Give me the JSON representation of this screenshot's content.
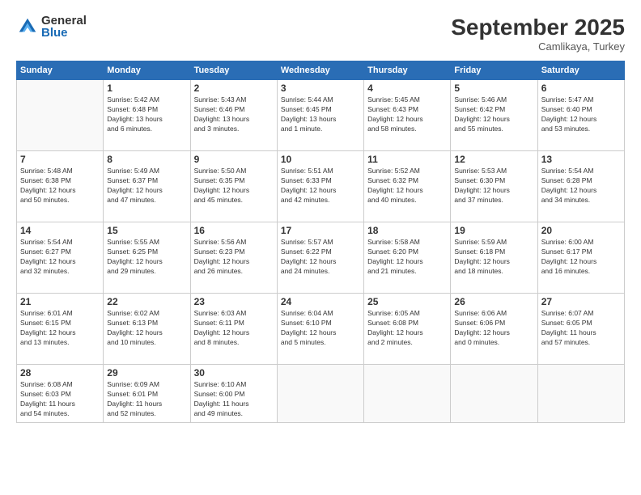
{
  "logo": {
    "general": "General",
    "blue": "Blue"
  },
  "header": {
    "month": "September 2025",
    "location": "Camlikaya, Turkey"
  },
  "weekdays": [
    "Sunday",
    "Monday",
    "Tuesday",
    "Wednesday",
    "Thursday",
    "Friday",
    "Saturday"
  ],
  "weeks": [
    [
      {
        "day": "",
        "info": ""
      },
      {
        "day": "1",
        "info": "Sunrise: 5:42 AM\nSunset: 6:48 PM\nDaylight: 13 hours\nand 6 minutes."
      },
      {
        "day": "2",
        "info": "Sunrise: 5:43 AM\nSunset: 6:46 PM\nDaylight: 13 hours\nand 3 minutes."
      },
      {
        "day": "3",
        "info": "Sunrise: 5:44 AM\nSunset: 6:45 PM\nDaylight: 13 hours\nand 1 minute."
      },
      {
        "day": "4",
        "info": "Sunrise: 5:45 AM\nSunset: 6:43 PM\nDaylight: 12 hours\nand 58 minutes."
      },
      {
        "day": "5",
        "info": "Sunrise: 5:46 AM\nSunset: 6:42 PM\nDaylight: 12 hours\nand 55 minutes."
      },
      {
        "day": "6",
        "info": "Sunrise: 5:47 AM\nSunset: 6:40 PM\nDaylight: 12 hours\nand 53 minutes."
      }
    ],
    [
      {
        "day": "7",
        "info": "Sunrise: 5:48 AM\nSunset: 6:38 PM\nDaylight: 12 hours\nand 50 minutes."
      },
      {
        "day": "8",
        "info": "Sunrise: 5:49 AM\nSunset: 6:37 PM\nDaylight: 12 hours\nand 47 minutes."
      },
      {
        "day": "9",
        "info": "Sunrise: 5:50 AM\nSunset: 6:35 PM\nDaylight: 12 hours\nand 45 minutes."
      },
      {
        "day": "10",
        "info": "Sunrise: 5:51 AM\nSunset: 6:33 PM\nDaylight: 12 hours\nand 42 minutes."
      },
      {
        "day": "11",
        "info": "Sunrise: 5:52 AM\nSunset: 6:32 PM\nDaylight: 12 hours\nand 40 minutes."
      },
      {
        "day": "12",
        "info": "Sunrise: 5:53 AM\nSunset: 6:30 PM\nDaylight: 12 hours\nand 37 minutes."
      },
      {
        "day": "13",
        "info": "Sunrise: 5:54 AM\nSunset: 6:28 PM\nDaylight: 12 hours\nand 34 minutes."
      }
    ],
    [
      {
        "day": "14",
        "info": "Sunrise: 5:54 AM\nSunset: 6:27 PM\nDaylight: 12 hours\nand 32 minutes."
      },
      {
        "day": "15",
        "info": "Sunrise: 5:55 AM\nSunset: 6:25 PM\nDaylight: 12 hours\nand 29 minutes."
      },
      {
        "day": "16",
        "info": "Sunrise: 5:56 AM\nSunset: 6:23 PM\nDaylight: 12 hours\nand 26 minutes."
      },
      {
        "day": "17",
        "info": "Sunrise: 5:57 AM\nSunset: 6:22 PM\nDaylight: 12 hours\nand 24 minutes."
      },
      {
        "day": "18",
        "info": "Sunrise: 5:58 AM\nSunset: 6:20 PM\nDaylight: 12 hours\nand 21 minutes."
      },
      {
        "day": "19",
        "info": "Sunrise: 5:59 AM\nSunset: 6:18 PM\nDaylight: 12 hours\nand 18 minutes."
      },
      {
        "day": "20",
        "info": "Sunrise: 6:00 AM\nSunset: 6:17 PM\nDaylight: 12 hours\nand 16 minutes."
      }
    ],
    [
      {
        "day": "21",
        "info": "Sunrise: 6:01 AM\nSunset: 6:15 PM\nDaylight: 12 hours\nand 13 minutes."
      },
      {
        "day": "22",
        "info": "Sunrise: 6:02 AM\nSunset: 6:13 PM\nDaylight: 12 hours\nand 10 minutes."
      },
      {
        "day": "23",
        "info": "Sunrise: 6:03 AM\nSunset: 6:11 PM\nDaylight: 12 hours\nand 8 minutes."
      },
      {
        "day": "24",
        "info": "Sunrise: 6:04 AM\nSunset: 6:10 PM\nDaylight: 12 hours\nand 5 minutes."
      },
      {
        "day": "25",
        "info": "Sunrise: 6:05 AM\nSunset: 6:08 PM\nDaylight: 12 hours\nand 2 minutes."
      },
      {
        "day": "26",
        "info": "Sunrise: 6:06 AM\nSunset: 6:06 PM\nDaylight: 12 hours\nand 0 minutes."
      },
      {
        "day": "27",
        "info": "Sunrise: 6:07 AM\nSunset: 6:05 PM\nDaylight: 11 hours\nand 57 minutes."
      }
    ],
    [
      {
        "day": "28",
        "info": "Sunrise: 6:08 AM\nSunset: 6:03 PM\nDaylight: 11 hours\nand 54 minutes."
      },
      {
        "day": "29",
        "info": "Sunrise: 6:09 AM\nSunset: 6:01 PM\nDaylight: 11 hours\nand 52 minutes."
      },
      {
        "day": "30",
        "info": "Sunrise: 6:10 AM\nSunset: 6:00 PM\nDaylight: 11 hours\nand 49 minutes."
      },
      {
        "day": "",
        "info": ""
      },
      {
        "day": "",
        "info": ""
      },
      {
        "day": "",
        "info": ""
      },
      {
        "day": "",
        "info": ""
      }
    ]
  ]
}
